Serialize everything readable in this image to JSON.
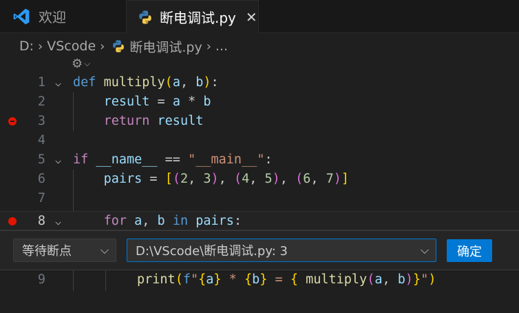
{
  "tabs": [
    {
      "label": "欢迎",
      "icon": "vscode-icon",
      "active": false
    },
    {
      "label": "断电调试.py",
      "icon": "python-icon",
      "active": true,
      "close": "✕"
    }
  ],
  "breadcrumb": {
    "drive": "D:",
    "folder": "VScode",
    "file": "断电调试.py",
    "more": "..."
  },
  "editor": {
    "lines": [
      {
        "n": "1"
      },
      {
        "n": "2"
      },
      {
        "n": "3"
      },
      {
        "n": "4"
      },
      {
        "n": "5"
      },
      {
        "n": "6"
      },
      {
        "n": "7"
      },
      {
        "n": "8"
      },
      {
        "n": "9"
      }
    ],
    "breakpoints": [
      {
        "line": "3",
        "kind": "unverified"
      },
      {
        "line": "8",
        "kind": "verified"
      }
    ]
  },
  "breakpoint_widget": {
    "type_value": "等待断点",
    "location_value": "D:\\VScode\\断电调试.py: 3",
    "confirm_label": "确定"
  },
  "colors": {
    "accent": "#0078d4",
    "breakpoint": "#e51400",
    "background": "#1f1f1f"
  }
}
